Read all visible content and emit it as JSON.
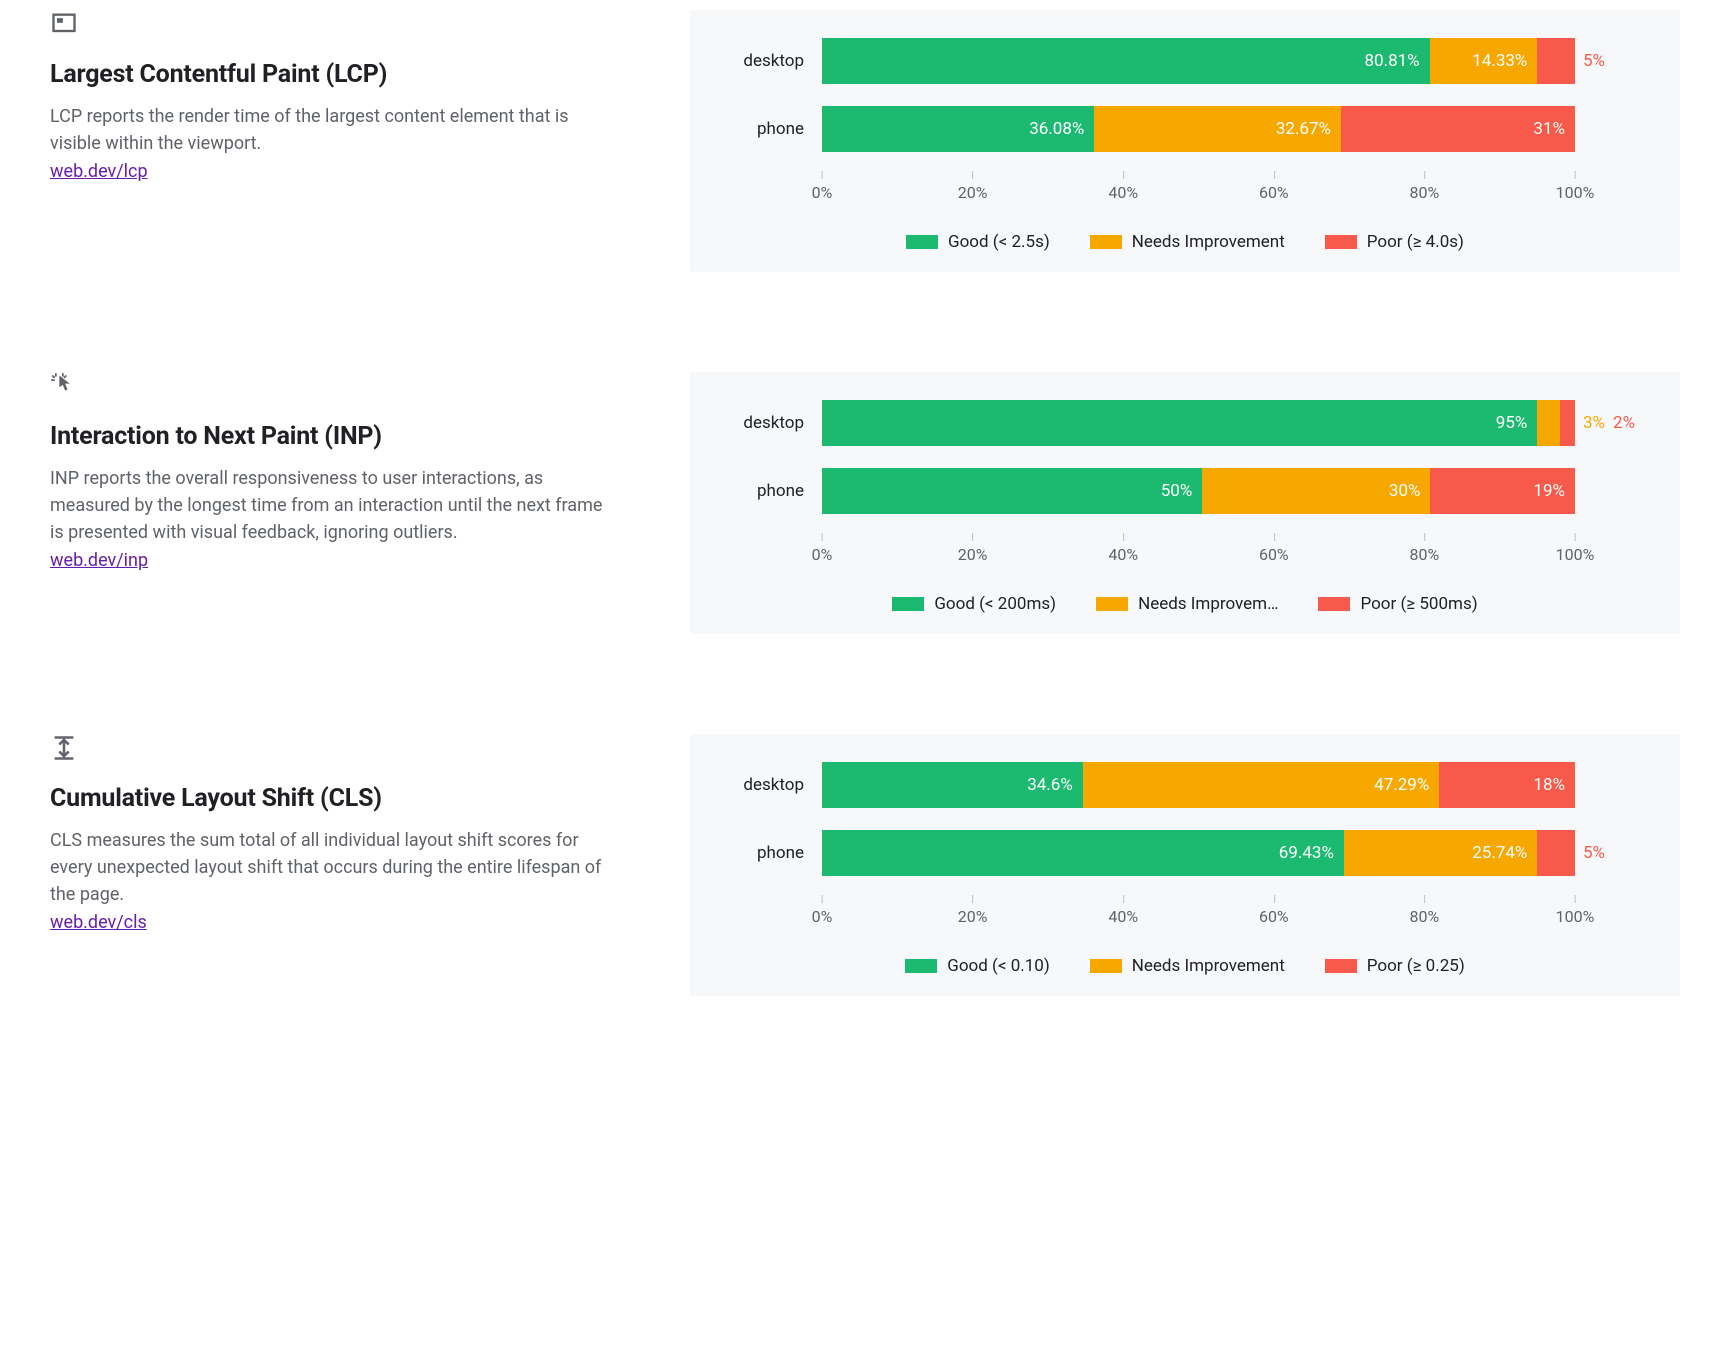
{
  "colors": {
    "good": "#1bba70",
    "needs": "#f7a800",
    "poor": "#f75a4b"
  },
  "axis_ticks": [
    "0%",
    "20%",
    "40%",
    "60%",
    "80%",
    "100%"
  ],
  "metrics": [
    {
      "id": "lcp",
      "title": "Largest Contentful Paint (LCP)",
      "desc": "LCP reports the render time of the largest content element that is visible within the viewport.",
      "link": "web.dev/lcp",
      "legend": {
        "good": "Good (< 2.5s)",
        "needs": "Needs Improvement",
        "poor": "Poor (≥ 4.0s)"
      },
      "rows": [
        {
          "label": "desktop",
          "good": 80.81,
          "needs": 14.33,
          "poor": 5,
          "good_lbl": "80.81%",
          "needs_lbl": "14.33%",
          "poor_lbl": "5%",
          "poor_outside": true
        },
        {
          "label": "phone",
          "good": 36.08,
          "needs": 32.67,
          "poor": 31,
          "good_lbl": "36.08%",
          "needs_lbl": "32.67%",
          "poor_lbl": "31%"
        }
      ]
    },
    {
      "id": "inp",
      "title": "Interaction to Next Paint (INP)",
      "desc": "INP reports the overall responsiveness to user interactions, as measured by the longest time from an interaction until the next frame is presented with visual feedback, ignoring outliers.",
      "link": "web.dev/inp",
      "legend": {
        "good": "Good (< 200ms)",
        "needs": "Needs Improvem…",
        "poor": "Poor (≥ 500ms)"
      },
      "rows": [
        {
          "label": "desktop",
          "good": 95,
          "needs": 3,
          "poor": 2,
          "good_lbl": "95%",
          "needs_lbl": "3%",
          "poor_lbl": "2%",
          "needs_outside": true,
          "poor_outside": true
        },
        {
          "label": "phone",
          "good": 50,
          "needs": 30,
          "poor": 19,
          "good_lbl": "50%",
          "needs_lbl": "30%",
          "poor_lbl": "19%"
        }
      ]
    },
    {
      "id": "cls",
      "title": "Cumulative Layout Shift (CLS)",
      "desc": "CLS measures the sum total of all individual layout shift scores for every unexpected layout shift that occurs during the entire lifespan of the page.",
      "link": "web.dev/cls",
      "legend": {
        "good": "Good (< 0.10)",
        "needs": "Needs Improvement",
        "poor": "Poor (≥ 0.25)"
      },
      "rows": [
        {
          "label": "desktop",
          "good": 34.6,
          "needs": 47.29,
          "poor": 18,
          "good_lbl": "34.6%",
          "needs_lbl": "47.29%",
          "poor_lbl": "18%"
        },
        {
          "label": "phone",
          "good": 69.43,
          "needs": 25.74,
          "poor": 5,
          "good_lbl": "69.43%",
          "needs_lbl": "25.74%",
          "poor_lbl": "5%",
          "poor_outside": true
        }
      ]
    }
  ],
  "chart_data": [
    {
      "type": "bar",
      "title": "Largest Contentful Paint (LCP)",
      "xlabel": "",
      "ylabel": "",
      "ylim": [
        0,
        100
      ],
      "categories": [
        "desktop",
        "phone"
      ],
      "series": [
        {
          "name": "Good (< 2.5s)",
          "values": [
            80.81,
            36.08
          ]
        },
        {
          "name": "Needs Improvement",
          "values": [
            14.33,
            32.67
          ]
        },
        {
          "name": "Poor (≥ 4.0s)",
          "values": [
            5,
            31
          ]
        }
      ]
    },
    {
      "type": "bar",
      "title": "Interaction to Next Paint (INP)",
      "xlabel": "",
      "ylabel": "",
      "ylim": [
        0,
        100
      ],
      "categories": [
        "desktop",
        "phone"
      ],
      "series": [
        {
          "name": "Good (< 200ms)",
          "values": [
            95,
            50
          ]
        },
        {
          "name": "Needs Improvement",
          "values": [
            3,
            30
          ]
        },
        {
          "name": "Poor (≥ 500ms)",
          "values": [
            2,
            19
          ]
        }
      ]
    },
    {
      "type": "bar",
      "title": "Cumulative Layout Shift (CLS)",
      "xlabel": "",
      "ylabel": "",
      "ylim": [
        0,
        100
      ],
      "categories": [
        "desktop",
        "phone"
      ],
      "series": [
        {
          "name": "Good (< 0.10)",
          "values": [
            34.6,
            69.43
          ]
        },
        {
          "name": "Needs Improvement",
          "values": [
            47.29,
            25.74
          ]
        },
        {
          "name": "Poor (≥ 0.25)",
          "values": [
            18,
            5
          ]
        }
      ]
    }
  ]
}
